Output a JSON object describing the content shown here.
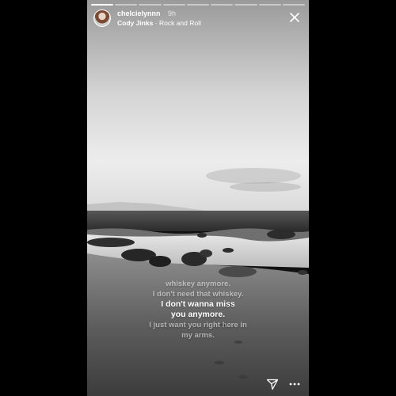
{
  "story": {
    "user": {
      "username": "chelcielynnn",
      "time_ago": "9h"
    },
    "music": {
      "artist": "Cody Jinks",
      "separator": "·",
      "song": "Rock and Roll"
    },
    "progress": {
      "segments": 9,
      "current_index": 0,
      "completed": 1
    },
    "lyrics": [
      {
        "text": "whiskey anymore.",
        "state": "dim"
      },
      {
        "text": "I don't need that whiskey.",
        "state": "dim"
      },
      {
        "text": "I don't wanna miss",
        "state": "active"
      },
      {
        "text": "you anymore.",
        "state": "active"
      },
      {
        "text": "I just want you right here in",
        "state": "dim"
      },
      {
        "text": "my arms.",
        "state": "dim"
      }
    ],
    "icons": {
      "close": "close-icon",
      "send": "send-icon",
      "more": "more-options-icon"
    },
    "colors": {
      "background": "#000000",
      "text": "#ffffff"
    }
  }
}
